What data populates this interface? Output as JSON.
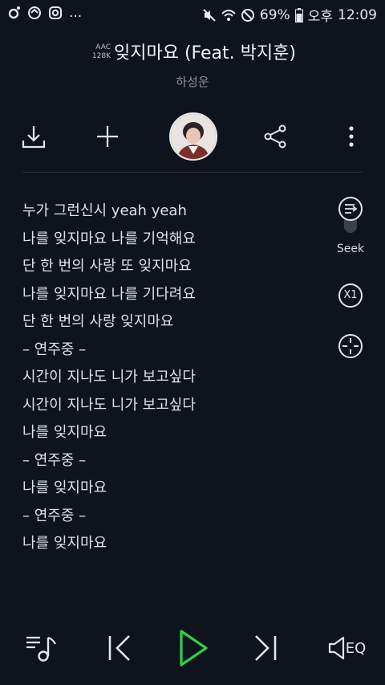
{
  "status_bar": {
    "battery": "69%",
    "ampm": "오후",
    "time": "12:09",
    "more_indicator": "..."
  },
  "header": {
    "codec_line1": "AAC",
    "codec_line2": "128K",
    "title": "잊지마요 (Feat. 박지훈)",
    "artist": "하성운"
  },
  "controls": {
    "icons": [
      "download-icon",
      "add-icon",
      "album-art",
      "share-icon",
      "more-vertical-icon"
    ]
  },
  "lyrics": [
    "누가 그런신시 yeah yeah",
    "나를 잊지마요 나를 기억해요",
    "단 한 번의 사랑 또 잊지마요",
    "나를 잊지마요 나를 기다려요",
    "단 한 번의 사랑 잊지마요",
    "– 연주중 –",
    "시간이 지나도 니가 보고싶다",
    "시간이 지나도 니가 보고싶다",
    "나를 잊지마요",
    "– 연주중 –",
    "나를 잊지마요",
    "– 연주중 –",
    "나를 잊지마요"
  ],
  "side_tools": {
    "seek_label": "Seek",
    "speed_label": "X1"
  },
  "bottom_bar": {
    "eq_label": "EQ"
  },
  "colors": {
    "background": "#0e131c",
    "play_accent": "#2bd14f",
    "text": "#dfe3e8",
    "muted": "#8b929b"
  }
}
